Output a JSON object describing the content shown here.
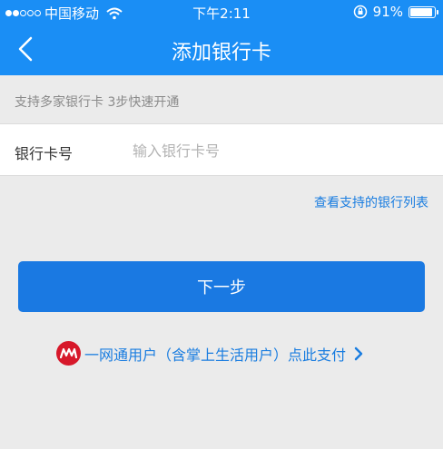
{
  "status_bar": {
    "carrier": "中国移动",
    "time": "下午2:11",
    "battery": "91%",
    "battery_level": 0.91,
    "signal_bars_filled": 2,
    "signal_bars_total": 5
  },
  "nav": {
    "title": "添加银行卡",
    "back_icon": "chevron-left-icon"
  },
  "notice": {
    "text": "支持多家银行卡 3步快速开通"
  },
  "card_field": {
    "label": "银行卡号",
    "placeholder": "输入银行卡号",
    "value": ""
  },
  "bank_list_link": "查看支持的银行列表",
  "next_button": "下一步",
  "ywt": {
    "text": "一网通用户（含掌上生活用户）点此支付",
    "logo_icon": "yiwangtong-logo-icon",
    "chevron_icon": "chevron-right-icon"
  },
  "colors": {
    "header_bg": "#1a8ef5",
    "primary_button": "#1a79e2",
    "link": "#1a7de0",
    "page_bg": "#ebebeb",
    "logo_red": "#d7182a"
  }
}
